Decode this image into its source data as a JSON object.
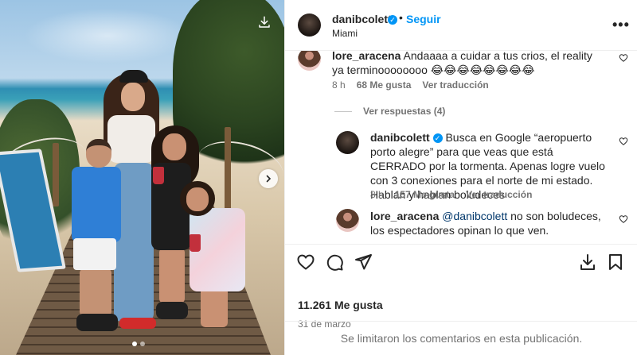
{
  "post": {
    "username": "danibcolett",
    "follow_label": "Seguir",
    "separator": "•",
    "location": "Miami",
    "more_label": "•••",
    "likes": "11.261 Me gusta",
    "date": "31 de marzo",
    "comments_disabled_notice": "Se limitaron los comentarios en esta publicación.",
    "carousel": {
      "count": 2,
      "active_index": 0
    }
  },
  "comments": [
    {
      "username": "lore_aracena",
      "text": "Andaaaa a cuidar a tus crios, el reality ya terminoooooooo 😂😂😂😂😂😂😂😂",
      "time": "8 h",
      "likes": "68 Me gusta",
      "translate_label": "Ver traducción"
    }
  ],
  "view_replies_label": "Ver respuestas (4)",
  "replies": [
    {
      "username": "danibcolett",
      "text": "Busca en Google “aeropuerto porto alegre” para que veas que está CERRADO por la tormenta. Apenas logre vuelo con 3 conexiones para el norte de mi estado. Hablan y hablan boludeces",
      "time": "8 h",
      "likes": "157 Me gusta",
      "translate_label": "Ver traducción"
    },
    {
      "username": "lore_aracena",
      "mention": "@danibcolett",
      "text": " no son boludeces, los espectadores opinan lo que ven."
    }
  ],
  "colors": {
    "accent": "#0095f6",
    "muted": "#737373",
    "text": "#262626",
    "mention": "#00376b"
  },
  "icons": {
    "download": "download-icon",
    "next": "chevron-right-icon",
    "verified": "verified-badge-icon",
    "heart": "heart-icon",
    "comment": "comment-icon",
    "share": "share-icon",
    "save": "bookmark-icon",
    "download_post": "download-icon"
  }
}
